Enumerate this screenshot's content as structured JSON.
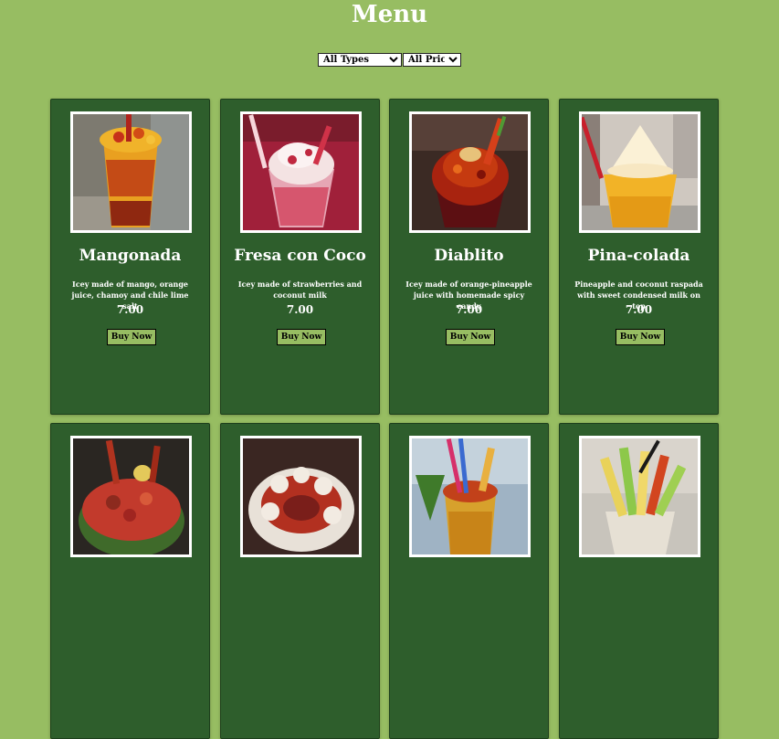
{
  "page": {
    "title": "Menu"
  },
  "filters": {
    "type_selected": "All Types",
    "price_selected": "All Prices"
  },
  "colors": {
    "background": "#97bd62",
    "card": "#2e5e2c",
    "text": "#ffffff"
  },
  "items": [
    {
      "name": "Mangonada",
      "description": "Icey made of mango, orange juice, chamoy and chile lime salt",
      "price": "7.00",
      "button": "Buy Now",
      "image": "mangonada-cup-image"
    },
    {
      "name": "Fresa con Coco",
      "description": "Icey made of strawberries and coconut milk",
      "price": "7.00",
      "button": "Buy Now",
      "image": "strawberry-coconut-cup-image"
    },
    {
      "name": "Diablito",
      "description": "Icey made of orange-pineapple juice with homemade spicy candy",
      "price": "7.00",
      "button": "Buy Now",
      "image": "diablito-cup-image"
    },
    {
      "name": "Pina-colada",
      "description": "Pineapple and coconut raspada with sweet condensed milk on top",
      "price": "7.00",
      "button": "Buy Now",
      "image": "pina-colada-cup-image"
    },
    {
      "image": "watermelon-fruit-bowl-image"
    },
    {
      "image": "apple-candy-platter-image"
    },
    {
      "image": "pineapple-cup-image"
    },
    {
      "image": "fruit-cup-image"
    }
  ]
}
